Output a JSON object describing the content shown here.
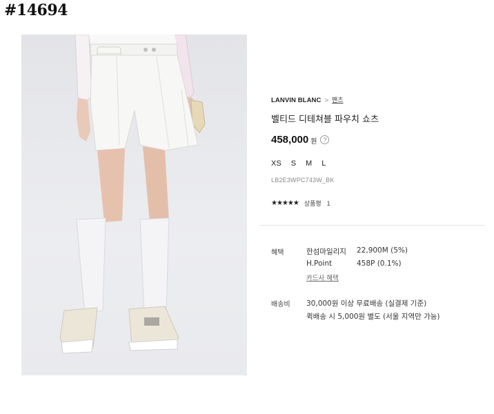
{
  "post_tag": "#14694",
  "product": {
    "brand": "LANVIN BLANC",
    "breadcrumb_separator": ">",
    "category": "팬츠",
    "title": "벨티드 디테쳐블 파우치 쇼츠",
    "price": "458,000",
    "currency": "원",
    "price_help_icon": "question-circle-icon",
    "sizes": [
      "XS",
      "S",
      "M",
      "L"
    ],
    "sku": "LB2E3WPC743W_BK",
    "rating_stars": "★★★★★",
    "rating_value": 5,
    "review_label": "상품평",
    "review_count": "1"
  },
  "benefits": {
    "label": "혜택",
    "mileage_label": "한섬마일리지",
    "mileage_value": "22,900M (5%)",
    "hpoint_label": "H.Point",
    "hpoint_value": "458P (0.1%)",
    "card_link": "카드사 혜택"
  },
  "shipping": {
    "label": "배송비",
    "line1": "30,000원 이상 무료배송 (실결제 기준)",
    "line2": "퀵배송 시 5,000원 별도 (서울 지역만 가능)"
  },
  "colors": {
    "background": "#ffffff",
    "photo_background": "#e8e9ec",
    "text_primary": "#222222",
    "text_muted": "#888888",
    "divider": "#e6e6e6"
  }
}
